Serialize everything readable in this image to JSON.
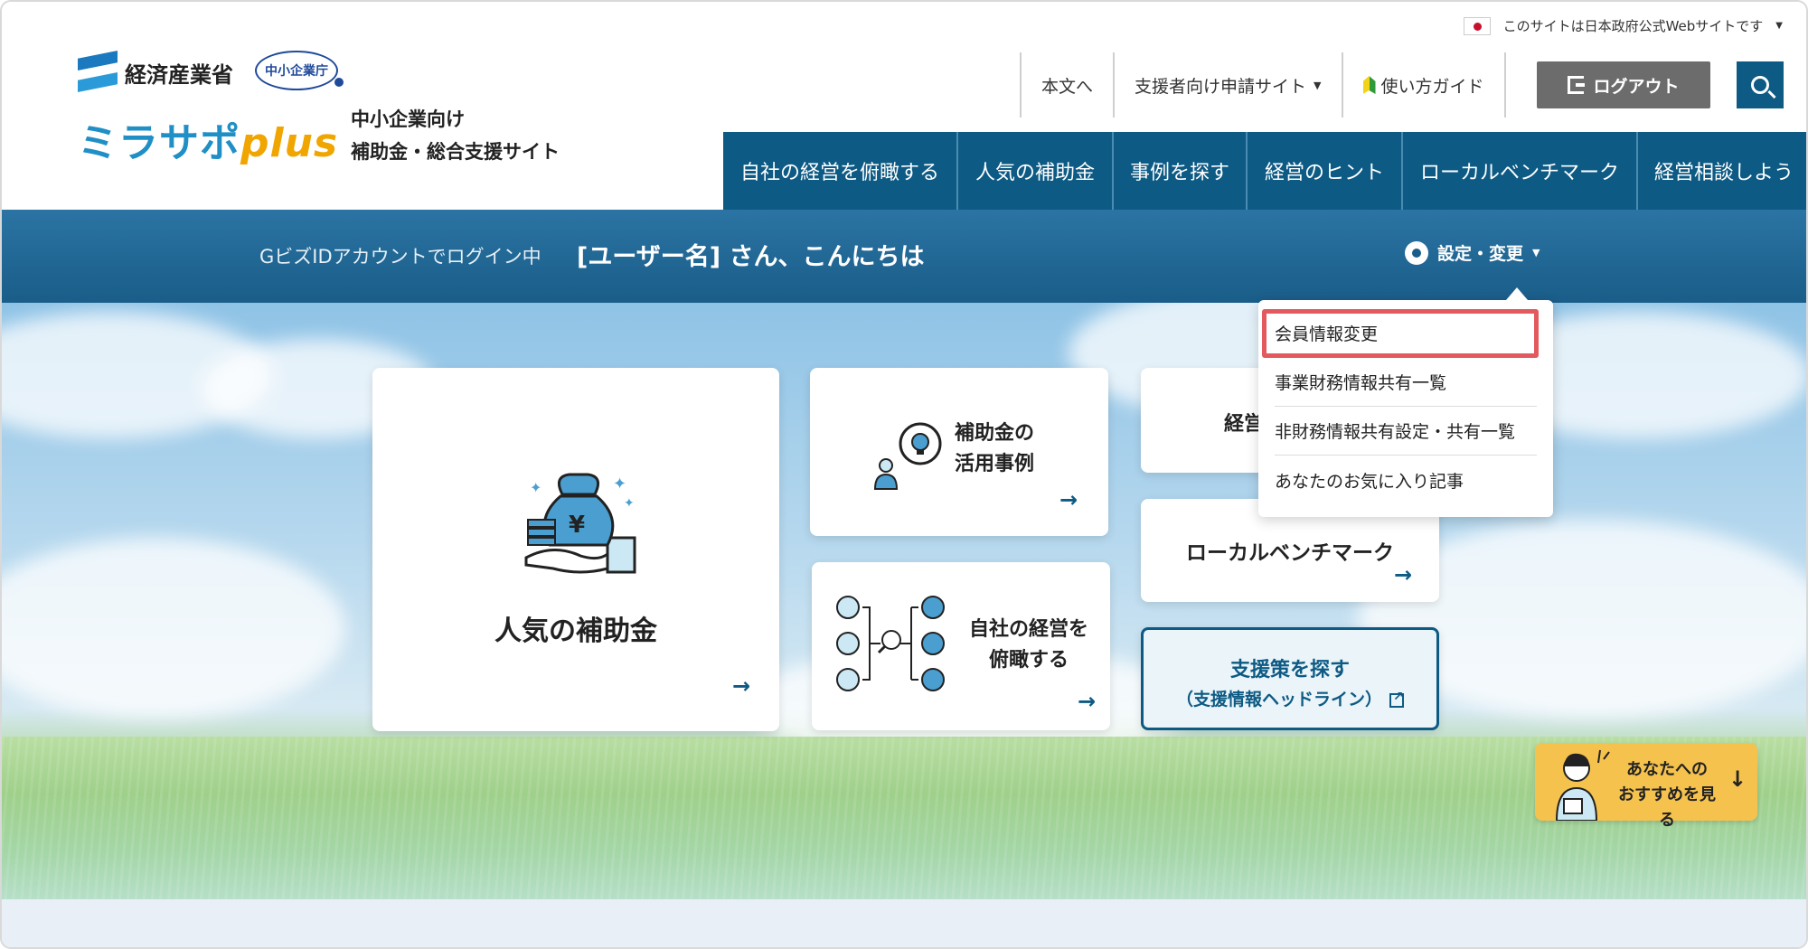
{
  "header": {
    "gov_notice": "このサイトは日本政府公式Webサイトです",
    "meti_label": "経済産業省",
    "agency_label": "中小企業庁",
    "logo_main": "ミラサポ",
    "logo_plus": "plus",
    "logo_sub_line1": "中小企業向け",
    "logo_sub_line2": "補助金・総合支援サイト",
    "util_nav": [
      {
        "label": "本文へ"
      },
      {
        "label": "支援者向け申請サイト"
      },
      {
        "label": "使い方ガイド"
      }
    ],
    "logout_label": "ログアウト",
    "main_nav": [
      {
        "label": "自社の経営を俯瞰する"
      },
      {
        "label": "人気の補助金"
      },
      {
        "label": "事例を探す"
      },
      {
        "label": "経営のヒント"
      },
      {
        "label": "ローカルベンチマーク"
      },
      {
        "label": "経営相談しよう"
      }
    ]
  },
  "login_bar": {
    "status": "GビズIDアカウントでログイン中",
    "greeting": "[ユーザー名] さん、こんにちは",
    "settings_label": "設定・変更"
  },
  "dropdown": {
    "items": [
      {
        "label": "会員情報変更"
      },
      {
        "label": "事業財務情報共有一覧"
      },
      {
        "label": "非財務情報共有設定・共有一覧"
      },
      {
        "label": "あなたのお気に入り記事"
      }
    ]
  },
  "cards": {
    "popular_subsidy": "人気の補助金",
    "case_line1": "補助金の",
    "case_line2": "活用事例",
    "overview_line1": "自社の経営を",
    "overview_line2": "俯瞰する",
    "keiei_partial": "経営",
    "local_benchmark": "ローカルベンチマーク",
    "support_title": "支援策を探す",
    "support_sub": "（支援情報ヘッドライン）"
  },
  "recommend": {
    "line1": "あなたへの",
    "line2": "おすすめを見る"
  },
  "colors": {
    "primary_blue": "#0d5a84",
    "highlight_red": "#e25a5e",
    "recommend_yellow": "#f6c24e"
  }
}
